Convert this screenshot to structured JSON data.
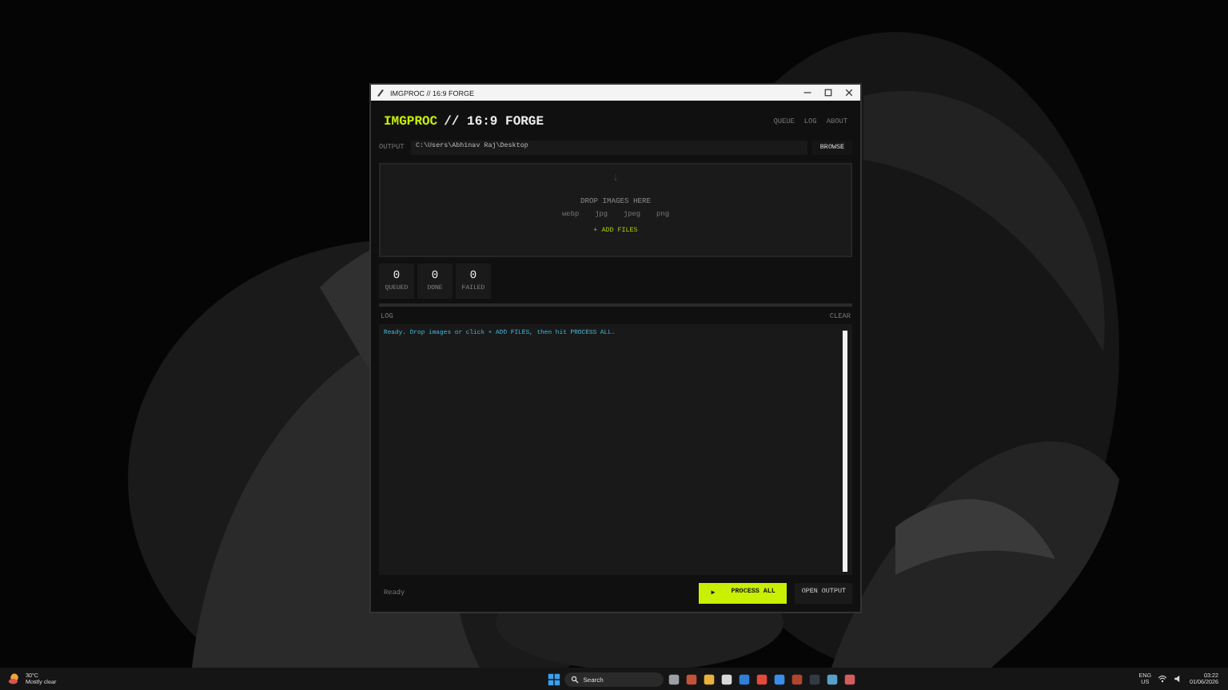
{
  "window": {
    "title": "IMGPROC // 16:9 FORGE"
  },
  "app": {
    "brand": "IMGPROC",
    "title": "// 16:9 FORGE",
    "nav": [
      {
        "label": "QUEUE",
        "selected": false
      },
      {
        "label": "LOG",
        "selected": false
      },
      {
        "label": "ABOUT",
        "selected": false
      }
    ],
    "output": {
      "label": "OUTPUT",
      "value": "C:\\Users\\Abhinav Raj\\Desktop",
      "button": "BROWSE"
    },
    "dropzone": {
      "icon": "↓",
      "title": "DROP IMAGES HERE",
      "formats": [
        "webp",
        "jpg",
        "jpeg",
        "png"
      ],
      "button": "+ ADD FILES"
    },
    "stats": [
      {
        "value": "0",
        "label": "QUEUED"
      },
      {
        "value": "0",
        "label": "DONE"
      },
      {
        "value": "0",
        "label": "FAILED"
      }
    ],
    "log": {
      "title": "LOG",
      "clear": "CLEAR",
      "lines": [
        "Ready. Drop images or click + ADD FILES, then hit PROCESS ALL."
      ]
    },
    "footer": {
      "status": "Ready",
      "process": "PROCESS ALL",
      "process_icon": "▶",
      "open": "OPEN OUTPUT"
    }
  },
  "taskbar": {
    "weather": {
      "temp": "30°C",
      "text": "Mostly clear"
    },
    "search": {
      "placeholder": "Search"
    },
    "tray": {
      "lang": "ENG",
      "region": "US",
      "time": "03:22",
      "date": "01/06/2026"
    }
  }
}
